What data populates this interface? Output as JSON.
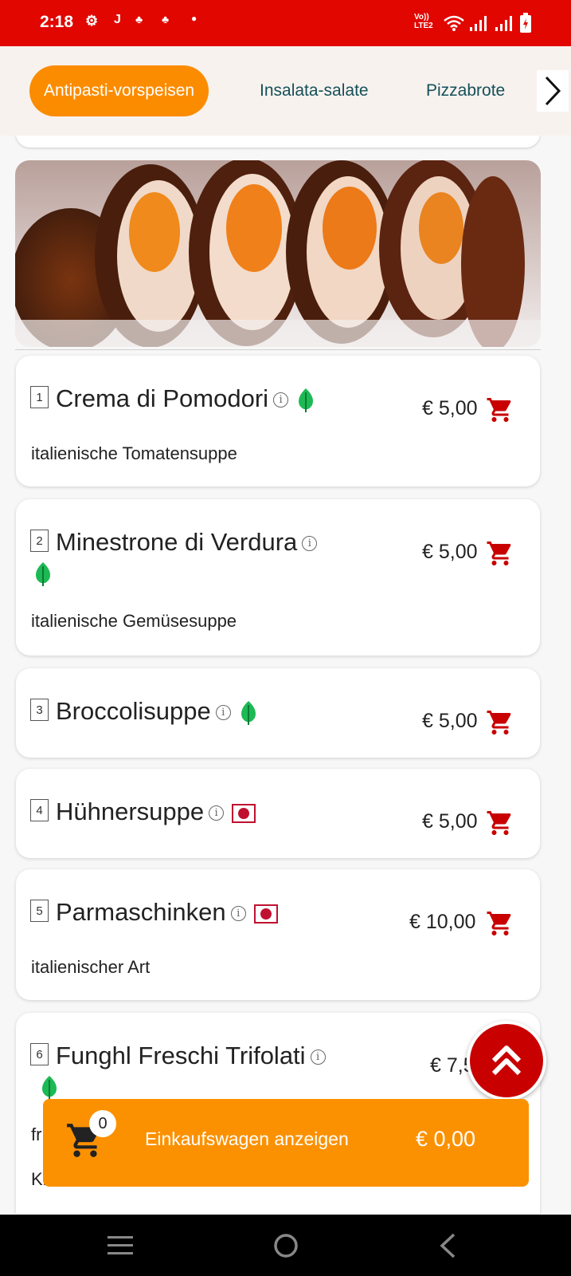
{
  "status_bar": {
    "time": "2:18",
    "right_text": "Vo)) LTE2"
  },
  "tabs": [
    {
      "label": "Antipasti-vorspeisen",
      "active": true
    },
    {
      "label": "Insalata-salate",
      "active": false
    },
    {
      "label": "Pizzabrote",
      "active": false
    }
  ],
  "items": [
    {
      "number": "1",
      "name": "Crema di Pomodori",
      "marker": "leaf-icon",
      "price": "€ 5,00",
      "description": "italienische Tomatensuppe"
    },
    {
      "number": "2",
      "name": "Minestrone di Verdura",
      "marker": "leaf-icon",
      "price": "€ 5,00",
      "description": "italienische Gemüsesuppe"
    },
    {
      "number": "3",
      "name": "Broccolisuppe",
      "marker": "leaf-icon",
      "price": "€ 5,00",
      "description": ""
    },
    {
      "number": "4",
      "name": "Hühnersuppe",
      "marker": "meat-icon",
      "price": "€ 5,00",
      "description": ""
    },
    {
      "number": "5",
      "name": "Parmaschinken",
      "marker": "meat-icon",
      "price": "€ 10,00",
      "description": "italienischer Art"
    },
    {
      "number": "6",
      "name": "Funghl Freschi Trifolati",
      "marker": "leaf-icon",
      "price": "€ 7,5",
      "description": "fr",
      "description_2": "Knoblauch"
    }
  ],
  "cart": {
    "count": "0",
    "label": "Einkaufswagen anzeigen",
    "total": "€ 0,00"
  },
  "colors": {
    "status_bar": "#e10600",
    "accent": "#fb8c00",
    "cart_icon": "#c80000",
    "veg": "#1db954",
    "meat": "#c01030"
  }
}
